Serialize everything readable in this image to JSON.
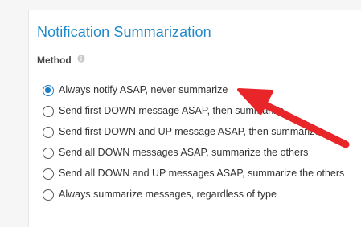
{
  "section": {
    "title": "Notification Summarization"
  },
  "method": {
    "label": "Method",
    "info_icon": "info-icon",
    "options": [
      {
        "label": "Always notify ASAP, never summarize",
        "selected": true
      },
      {
        "label": "Send first DOWN message ASAP, then summarize",
        "selected": false
      },
      {
        "label": "Send first DOWN and UP message ASAP, then summarize",
        "selected": false
      },
      {
        "label": "Send all DOWN messages ASAP, summarize the others",
        "selected": false
      },
      {
        "label": "Send all DOWN and UP messages ASAP, summarize the others",
        "selected": false
      },
      {
        "label": "Always summarize messages, regardless of type",
        "selected": false
      }
    ]
  },
  "annotation": {
    "icon": "red-arrow-icon",
    "color": "#e8262a"
  },
  "colors": {
    "accent": "#1f8ac8",
    "radio_selected": "#1f7fc4"
  }
}
